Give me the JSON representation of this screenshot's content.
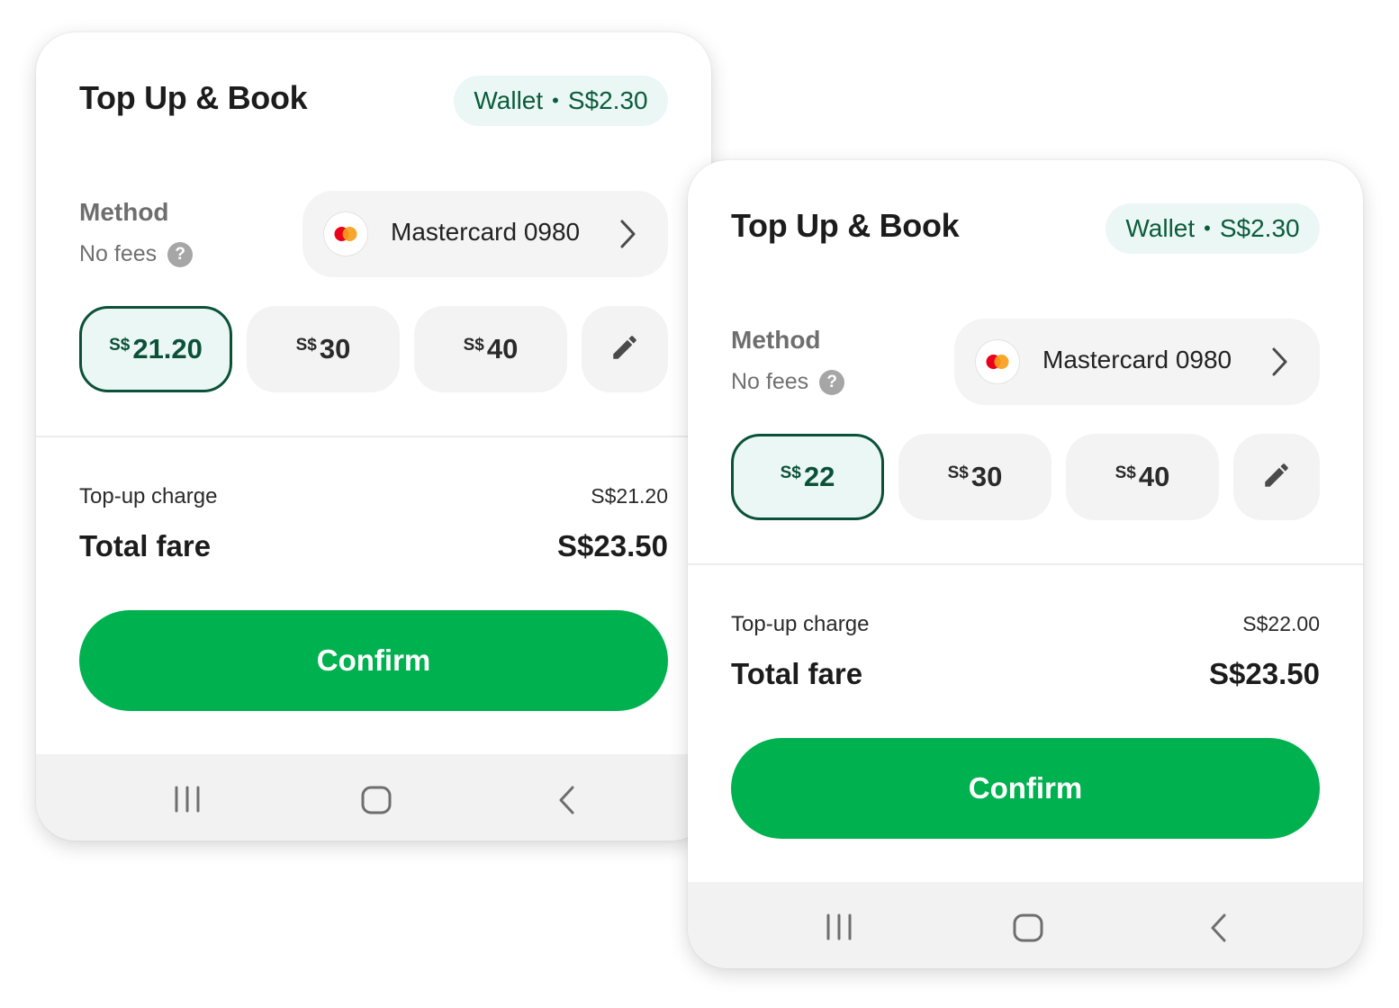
{
  "screens": [
    {
      "title": "Top Up & Book",
      "wallet": {
        "label": "Wallet",
        "balance": "S$2.30"
      },
      "method": {
        "label": "Method",
        "fees": "No fees",
        "card_name": "Mastercard 0980"
      },
      "amounts": [
        {
          "currency": "S$",
          "value": "21.20",
          "selected": true
        },
        {
          "currency": "S$",
          "value": "30",
          "selected": false
        },
        {
          "currency": "S$",
          "value": "40",
          "selected": false
        }
      ],
      "summary": {
        "topup_label": "Top-up charge",
        "topup_value": "S$21.20",
        "total_label": "Total fare",
        "total_value": "S$23.50"
      },
      "confirm_label": "Confirm"
    },
    {
      "title": "Top Up & Book",
      "wallet": {
        "label": "Wallet",
        "balance": "S$2.30"
      },
      "method": {
        "label": "Method",
        "fees": "No fees",
        "card_name": "Mastercard 0980"
      },
      "amounts": [
        {
          "currency": "S$",
          "value": "22",
          "selected": true
        },
        {
          "currency": "S$",
          "value": "30",
          "selected": false
        },
        {
          "currency": "S$",
          "value": "40",
          "selected": false
        }
      ],
      "summary": {
        "topup_label": "Top-up charge",
        "topup_value": "S$22.00",
        "total_label": "Total fare",
        "total_value": "S$23.50"
      },
      "confirm_label": "Confirm"
    }
  ],
  "help_icon_glyph": "?",
  "icons": {
    "card_logo": "mastercard-icon",
    "chevron": "chevron-right-icon",
    "edit": "pencil-icon",
    "nav": [
      "recent-apps-icon",
      "home-icon",
      "back-icon"
    ]
  },
  "colors": {
    "accent": "#00b14f",
    "selected_border": "#0b5137",
    "wallet_bg": "#ebf7f5",
    "wallet_text": "#0b5c3b",
    "mastercard_red": "#eb001b",
    "mastercard_orange": "#f79e1b"
  }
}
